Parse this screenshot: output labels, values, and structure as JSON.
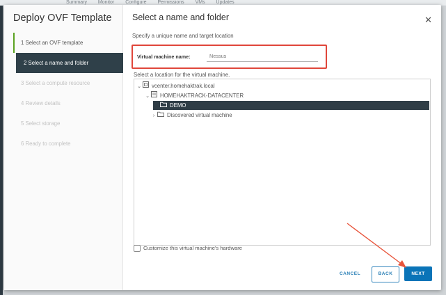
{
  "background": {
    "tabs": [
      "Summary",
      "Monitor",
      "Configure",
      "Permissions",
      "VMs",
      "Updates"
    ]
  },
  "wizard": {
    "title": "Deploy OVF Template",
    "steps": [
      {
        "label": "1  Select an OVF template",
        "state": "done"
      },
      {
        "label": "2  Select a name and folder",
        "state": "active"
      },
      {
        "label": "3  Select a compute resource",
        "state": "disabled"
      },
      {
        "label": "4  Review details",
        "state": "disabled"
      },
      {
        "label": "5  Select storage",
        "state": "disabled"
      },
      {
        "label": "6  Ready to complete",
        "state": "disabled"
      }
    ]
  },
  "main": {
    "title": "Select a name and folder",
    "subtitle": "Specify a unique name and target location",
    "vm_name_label": "Virtual machine name:",
    "vm_name_value": "Nessus",
    "location_label": "Select a location for the virtual machine.",
    "tree": [
      {
        "label": "vcenter.homehaktrak.local",
        "icon": "vcenter-icon"
      },
      {
        "label": "HOMEHAKTRACK-DATACENTER",
        "icon": "datacenter-icon"
      },
      {
        "label": "DEMO",
        "icon": "folder-icon",
        "selected": true
      },
      {
        "label": "Discovered virtual machine",
        "icon": "folder-icon"
      }
    ],
    "customize_label": "Customize this virtual machine's hardware"
  },
  "buttons": {
    "cancel": "CANCEL",
    "back": "BACK",
    "next": "NEXT"
  },
  "colors": {
    "highlight_box": "#e0463a",
    "arrow": "#e8553c",
    "primary": "#0a74b8",
    "selected_row": "#2f3d46",
    "done_step": "#5aa220"
  }
}
